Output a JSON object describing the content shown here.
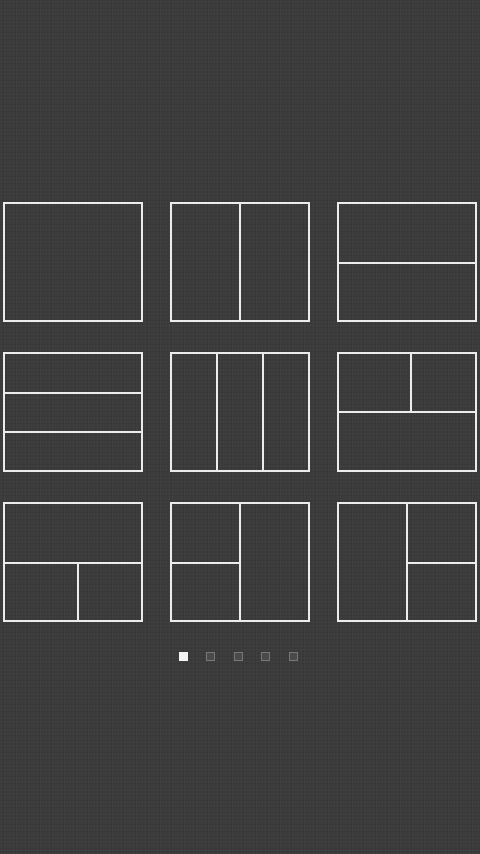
{
  "screen": {
    "name": "collage-layout-picker",
    "background_color": "#3a3a3a",
    "frame_color": "#ececec"
  },
  "layouts": [
    {
      "id": "single",
      "panels": 1
    },
    {
      "id": "two-columns",
      "panels": 2
    },
    {
      "id": "two-rows",
      "panels": 2
    },
    {
      "id": "three-rows",
      "panels": 3
    },
    {
      "id": "three-columns",
      "panels": 3
    },
    {
      "id": "two-top-one-bottom",
      "panels": 3
    },
    {
      "id": "one-top-two-bottom",
      "panels": 3
    },
    {
      "id": "two-left-one-right",
      "panels": 3
    },
    {
      "id": "one-left-two-right",
      "panels": 3
    }
  ],
  "pager": {
    "page_count": 5,
    "current_page": 1,
    "active_color": "#f4f4f4",
    "inactive_color": "#4a4a4a"
  }
}
